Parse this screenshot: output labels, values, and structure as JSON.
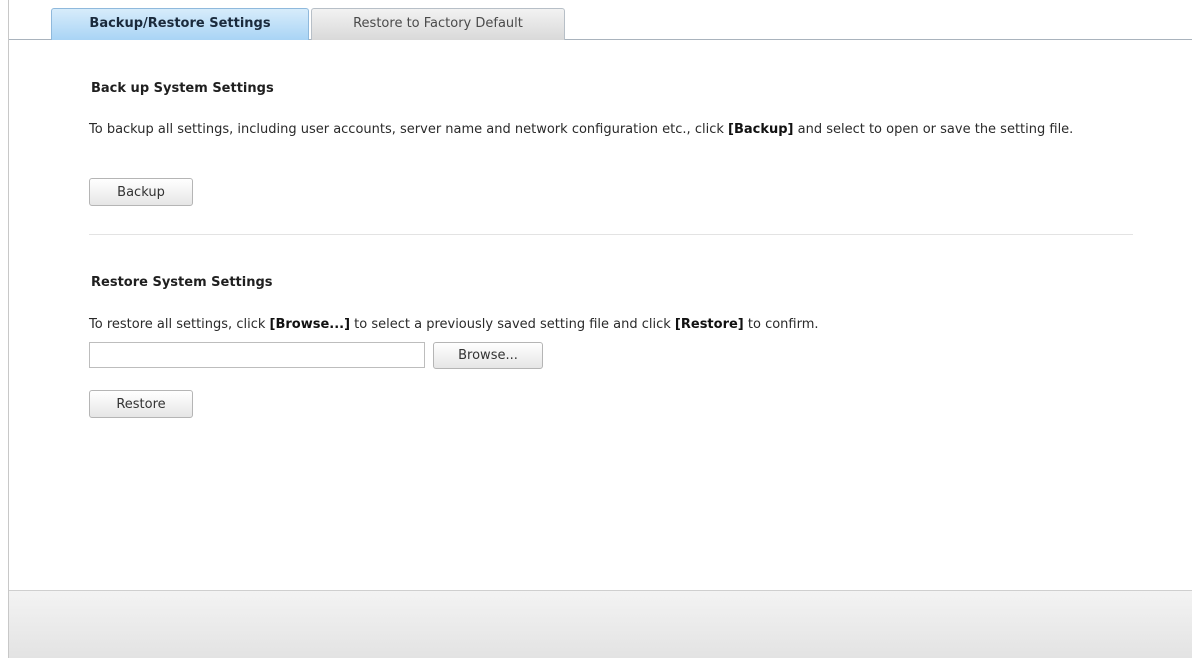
{
  "tabs": {
    "active_label": "Backup/Restore Settings",
    "inactive_label": "Restore to Factory Default"
  },
  "backup": {
    "heading": "Back up System Settings",
    "desc_before": "To backup all settings, including user accounts, server name and network configuration etc., click ",
    "desc_bold": "[Backup]",
    "desc_after": " and select to open or save the setting file.",
    "button_label": "Backup"
  },
  "restore": {
    "heading": "Restore System Settings",
    "desc_before": "To restore all settings, click ",
    "desc_bold_1": "[Browse...]",
    "desc_middle": " to select a previously saved setting file and click ",
    "desc_bold_2": "[Restore]",
    "desc_after": " to confirm.",
    "file_value": "",
    "browse_label": "Browse...",
    "button_label": "Restore"
  }
}
